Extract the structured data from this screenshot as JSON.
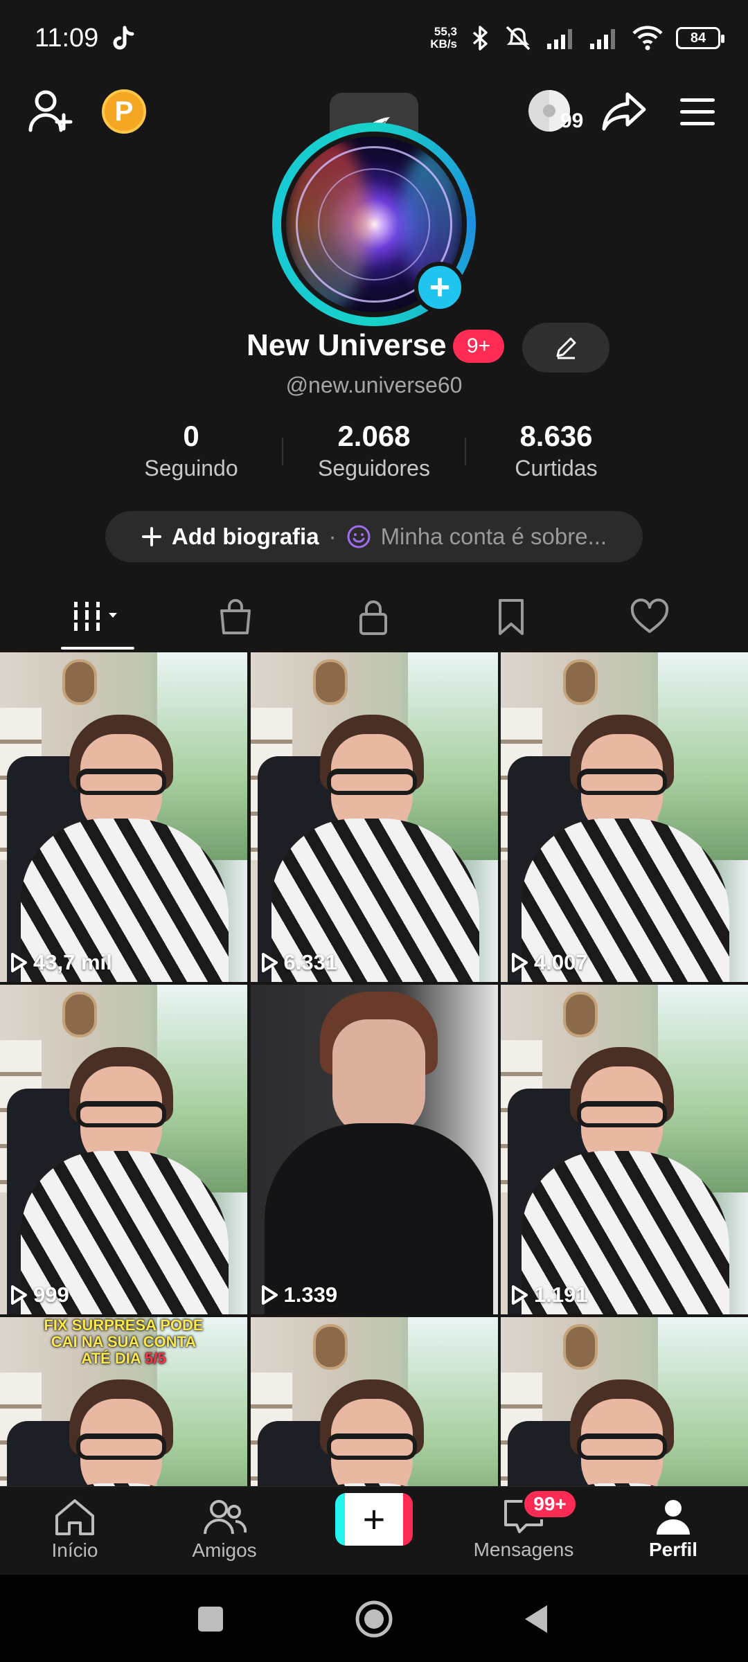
{
  "status_bar": {
    "time": "11:09",
    "net_speed_value": "55,3",
    "net_speed_unit": "KB/s",
    "battery": "84"
  },
  "top_bar": {
    "disc_count": "99",
    "coin_letter": "P"
  },
  "profile": {
    "name": "New Universe",
    "notification_badge": "9+",
    "handle": "@new.universe60"
  },
  "stats": [
    {
      "value": "0",
      "label": "Seguindo"
    },
    {
      "value": "2.068",
      "label": "Seguidores"
    },
    {
      "value": "8.636",
      "label": "Curtidas"
    }
  ],
  "bio": {
    "add_label": "Add biografia",
    "separator": "·",
    "placeholder": "Minha conta é sobre..."
  },
  "tabs": [
    "videos-icon",
    "shop-icon",
    "lock-icon",
    "bookmark-icon",
    "heart-icon"
  ],
  "videos": [
    {
      "views": "43,7 mil"
    },
    {
      "views": "6.331"
    },
    {
      "views": "4.007"
    },
    {
      "views": "999"
    },
    {
      "views": "1.339"
    },
    {
      "views": "1.191"
    },
    {
      "views": ""
    },
    {
      "views": ""
    },
    {
      "views": ""
    }
  ],
  "video_7_caption": {
    "line1": "FIX SURPRESA PODE",
    "line2": "CAI NA SUA CONTA",
    "line3_prefix": "ATÉ DIA",
    "line3_red": "5/5"
  },
  "bottom_nav": {
    "home": "Início",
    "friends": "Amigos",
    "messages": "Mensagens",
    "messages_badge": "99+",
    "profile": "Perfil"
  },
  "colors": {
    "background": "#161616",
    "accent_red": "#fe2c55",
    "accent_cyan": "#20c5ef",
    "coin": "#f5a623"
  }
}
